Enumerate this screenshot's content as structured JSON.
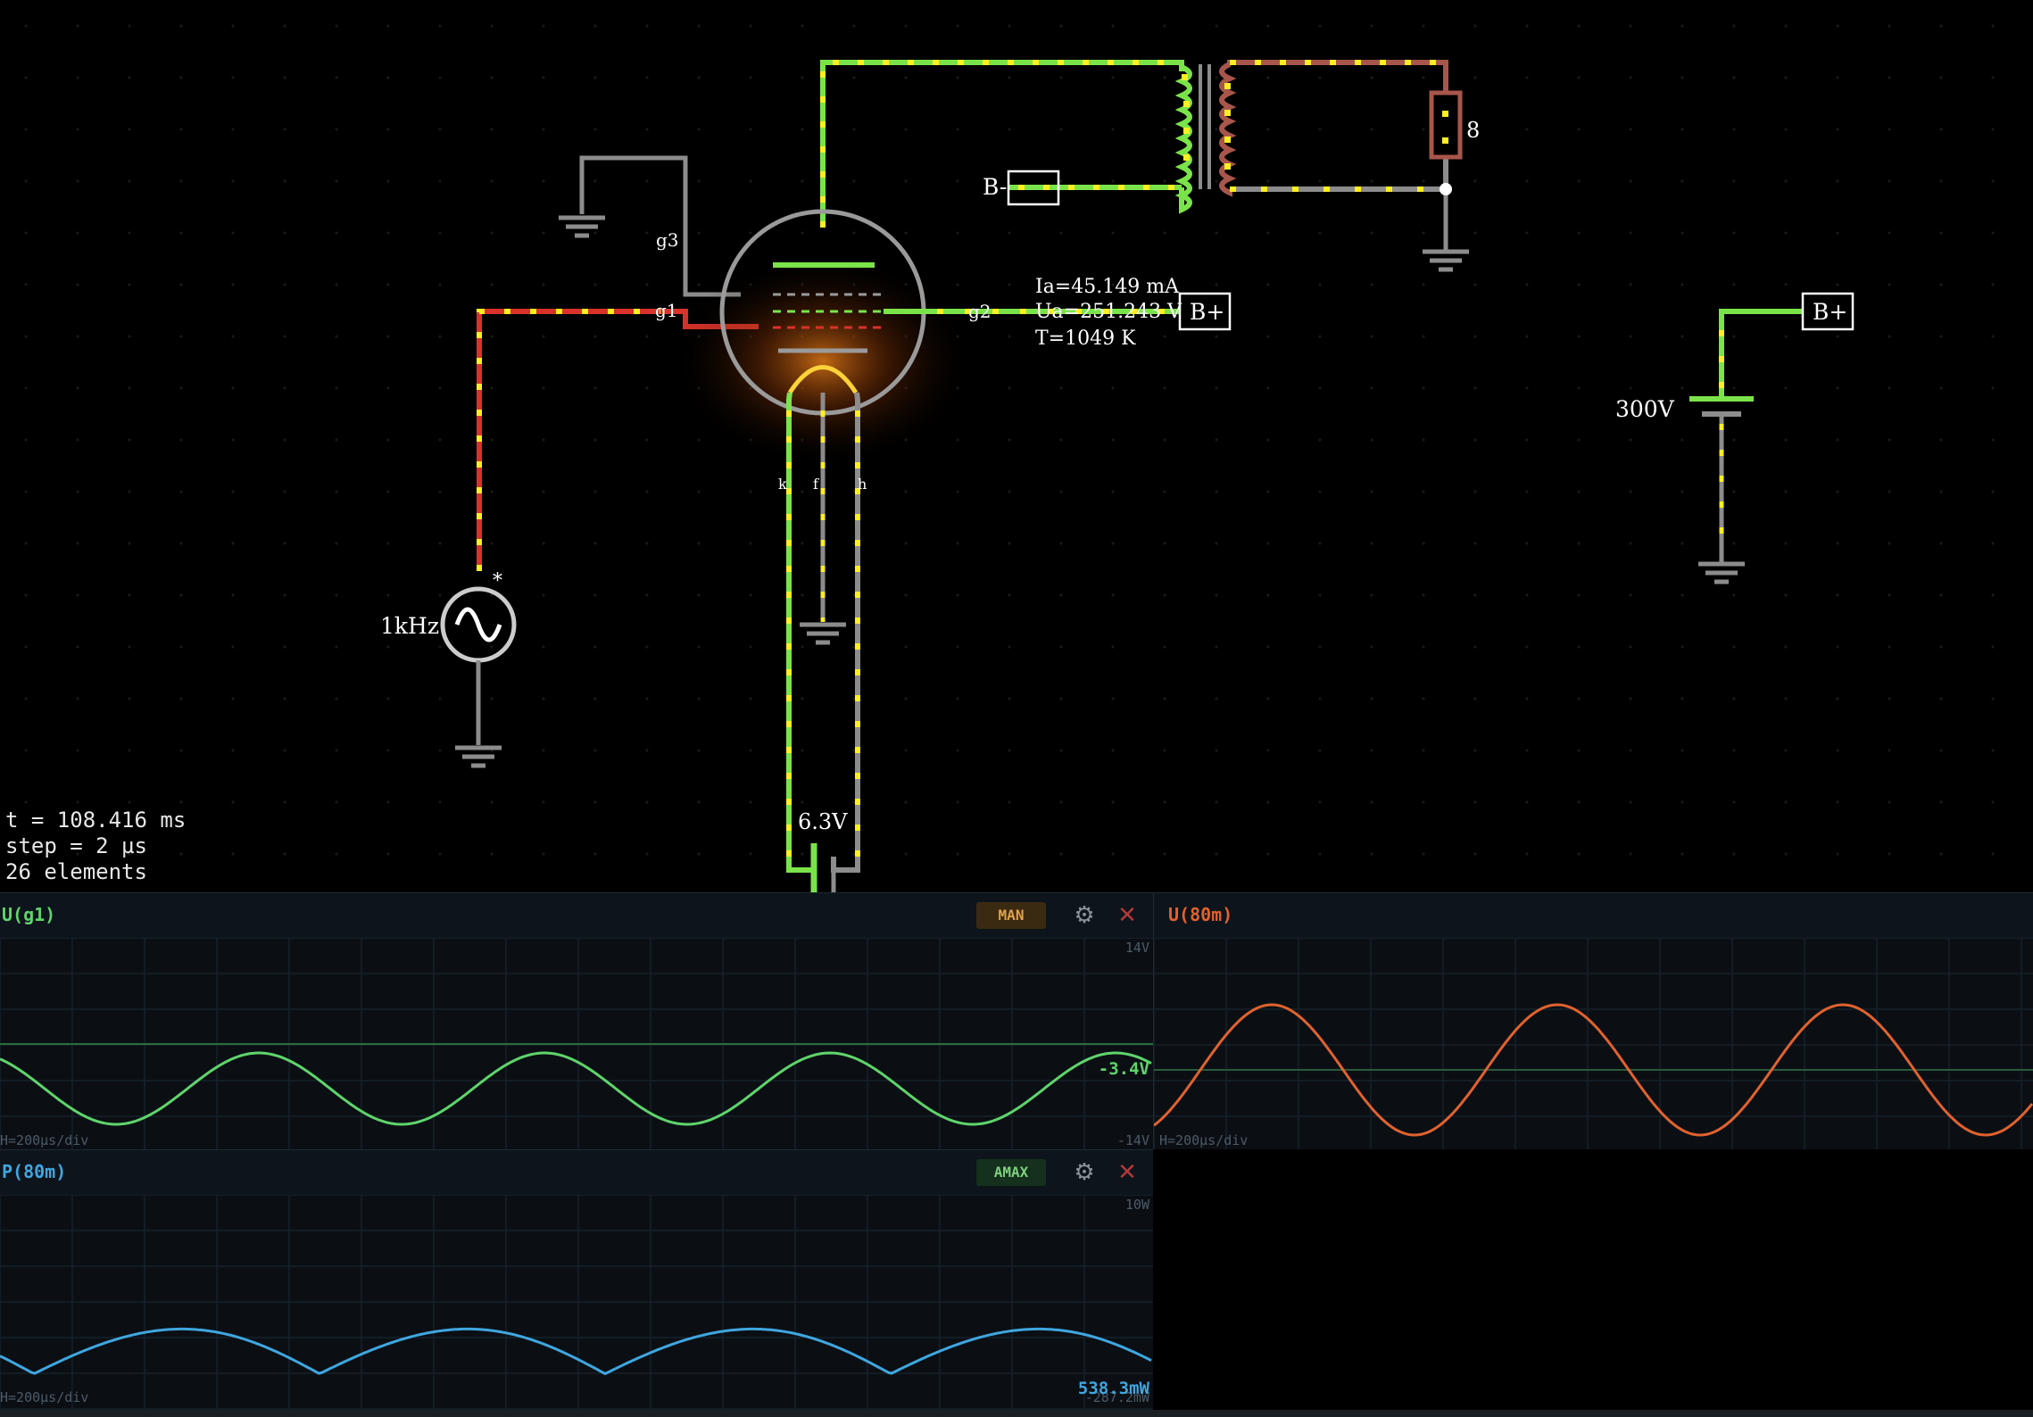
{
  "circuit": {
    "tube_readout": {
      "ia": "Ia=45.149 mA",
      "ua": "Ua=251.243 V",
      "temp": "T=1049 K"
    },
    "pins": {
      "g1": "g1",
      "g2": "g2",
      "g3": "g3",
      "k": "k",
      "f1": "f",
      "f2": "h"
    },
    "generator_label": "1kHz",
    "generator_marker": "*",
    "heater_voltage": "6.3V",
    "supply_voltage": "300V",
    "speaker_label": "8",
    "net_labels": {
      "b_minus": "B-",
      "b_plus_tube": "B+",
      "b_plus_supply": "B+"
    }
  },
  "sim_info": {
    "time": "t = 108.416 ms",
    "step": "step = 2 µs",
    "elements": "26 elements"
  },
  "scopes": {
    "ug1": {
      "title": "U(g1)",
      "mode": "MAN",
      "max": "14V",
      "min": "-14V",
      "value": "-3.4V",
      "hdiv": "H=200µs/div",
      "color": "#5fd46b"
    },
    "u80m": {
      "title": "U(80m)",
      "hdiv": "H=200µs/div",
      "color": "#e0622e"
    },
    "p80m": {
      "title": "P(80m)",
      "mode": "AMAX",
      "max": "10W",
      "min": "-287.2mW",
      "value": "538.3mW",
      "hdiv": "H=200µs/div",
      "color": "#3fa7e0"
    }
  },
  "colors": {
    "wire_green": "#7be34a",
    "wire_red": "#d8322a",
    "wire_gray": "#8c8c8c",
    "current_dot": "#ffee22",
    "coil_brown": "#a8564b"
  }
}
